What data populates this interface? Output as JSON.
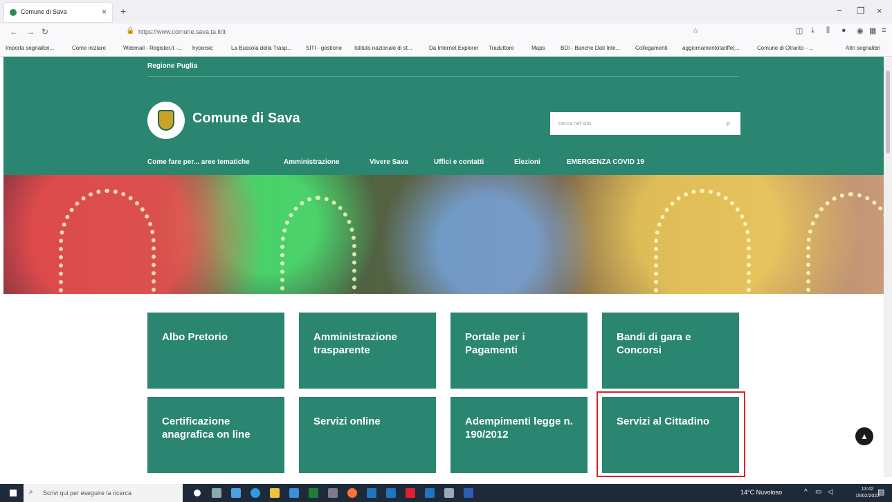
{
  "browser": {
    "tab_title": "Comune di Sava",
    "tab_close": "×",
    "new_tab": "+",
    "url": "https://www.comune.sava.ta.it/it",
    "window_controls": [
      "−",
      "❐",
      "×"
    ],
    "nav_icons": [
      "back-arrow-icon",
      "forward-arrow-icon",
      "reload-icon"
    ]
  },
  "bookmarks": [
    "Importa segnalibri...",
    "Come iniziare",
    "Webmail - Register.it -...",
    "hypersic",
    "La Bussola della Trasp...",
    "SITI - gestione",
    "Istituto nazionale di st...",
    "Da Internet Explorer",
    "Traduttore",
    "Maps",
    "BDI - Banche Dati Inte...",
    "Collegamenti",
    "aggiornamentotariffe(...",
    "Comune di Otranto - ...",
    "Altri segnalibri"
  ],
  "header": {
    "region": "Regione Puglia",
    "site_name": "Comune di Sava",
    "search_placeholder": "cerca nel sito"
  },
  "menu": [
    "Come fare per... aree tematiche",
    "Amministrazione",
    "Vivere Sava",
    "Uffici e contatti",
    "Elezioni",
    "EMERGENZA COVID 19"
  ],
  "tiles": [
    "Albo Pretorio",
    "Amministrazione trasparente",
    "Portale per i Pagamenti",
    "Bandi di gara e Concorsi",
    "Certificazione anagrafica on line",
    "Servizi online",
    "Adempimenti legge n. 190/2012",
    "Servizi al Cittadino"
  ],
  "taskbar": {
    "search_placeholder": "Scrivi qui per eseguire la ricerca",
    "weather": "14°C Nuvoloso",
    "time": "13:42",
    "date": "15/02/2022"
  },
  "colors": {
    "brand_green": "#2a8571",
    "highlight_red": "#e02020"
  }
}
